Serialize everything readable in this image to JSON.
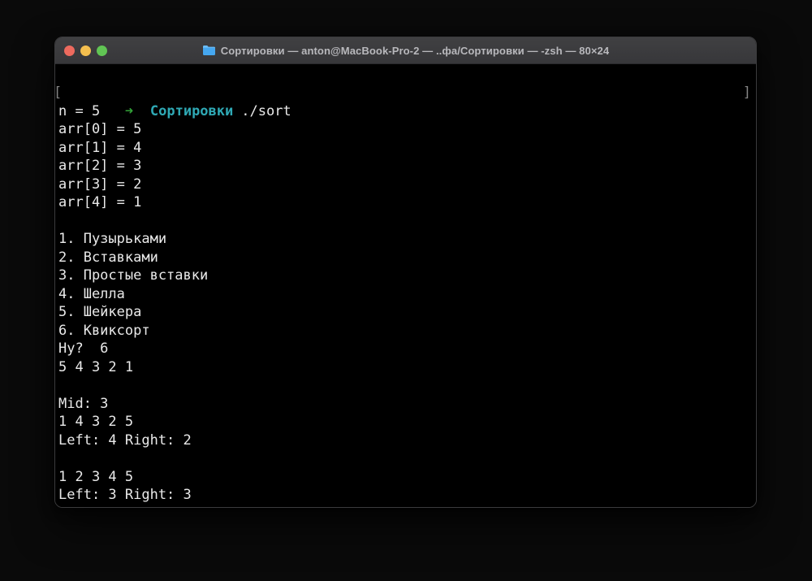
{
  "colors": {
    "desktop_bg": "#0a0a0a",
    "window_border": "#3b3b3d",
    "titlebar_text": "#b8b8bc",
    "traffic_red": "#ed6a5e",
    "traffic_yellow": "#f4bf4f",
    "traffic_green": "#61c554",
    "folder_blue": "#45a7f0",
    "folder_blue_light": "#6bbcf7",
    "term_bg": "#000000",
    "term_fg": "#e9e9e9",
    "arrow_green": "#33a439",
    "cwd_cyan": "#2fa9b5",
    "mark_gray": "#858585"
  },
  "window": {
    "title": "Сортировки — anton@MacBook-Pro-2 — ..фа/Сортировки — -zsh — 80×24"
  },
  "terminal": {
    "prompt": {
      "mark_left": "[",
      "arrow": "➜",
      "cwd": "Сортировки",
      "command": "./sort",
      "mark_right": "]"
    },
    "output_lines": [
      "n = 5",
      "arr[0] = 5",
      "arr[1] = 4",
      "arr[2] = 3",
      "arr[3] = 2",
      "arr[4] = 1",
      "",
      "1. Пузырьками",
      "2. Вставками",
      "3. Простые вставки",
      "4. Шелла",
      "5. Шейкера",
      "6. Квиксорт",
      "Ну?  6",
      "5 4 3 2 1",
      "",
      "Mid: 3",
      "1 4 3 2 5",
      "Left: 4 Right: 2",
      "",
      "1 2 3 4 5",
      "Left: 3 Right: 3"
    ]
  }
}
